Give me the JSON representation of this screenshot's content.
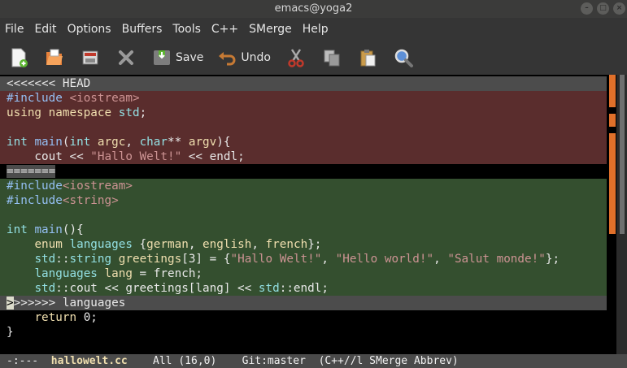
{
  "window": {
    "title": "emacs@yoga2"
  },
  "menu": [
    "File",
    "Edit",
    "Options",
    "Buffers",
    "Tools",
    "C++",
    "SMerge",
    "Help"
  ],
  "toolbar": {
    "save_label": "Save",
    "undo_label": "Undo",
    "icons": [
      "new-file-icon",
      "open-folder-icon",
      "dired-icon",
      "close-icon",
      "save-icon",
      "undo-icon",
      "cut-icon",
      "copy-icon",
      "paste-icon",
      "search-icon"
    ]
  },
  "editor": {
    "lines": [
      "<<<<<<< HEAD",
      "#include <iostream>",
      "using namespace std;",
      "",
      "int main(int argc, char** argv){",
      "    cout << \"Hallo Welt!\" << endl;",
      "=======",
      "#include<iostream>",
      "#include<string>",
      "",
      "int main(){",
      "    enum languages {german, english, french};",
      "    std::string greetings[3] = {\"Hallo Welt!\", \"Hello world!\", \"Salut monde!\"};",
      "    languages lang = french;",
      "    std::cout << greetings[lang] << std::endl;",
      ">>>>>>> languages",
      "    return 0;",
      "}"
    ]
  },
  "modeline": {
    "status": "-:---",
    "buffer": "hallowelt.cc",
    "position": "All (16,0)",
    "vc": "Git:master",
    "modes": "(C++//l SMerge Abbrev)"
  },
  "colors": {
    "head_bg": "#5a2d2d",
    "other_bg": "#344f2f",
    "marker_bg": "#4c4c4c",
    "fringe_mark": "#e0702a"
  }
}
